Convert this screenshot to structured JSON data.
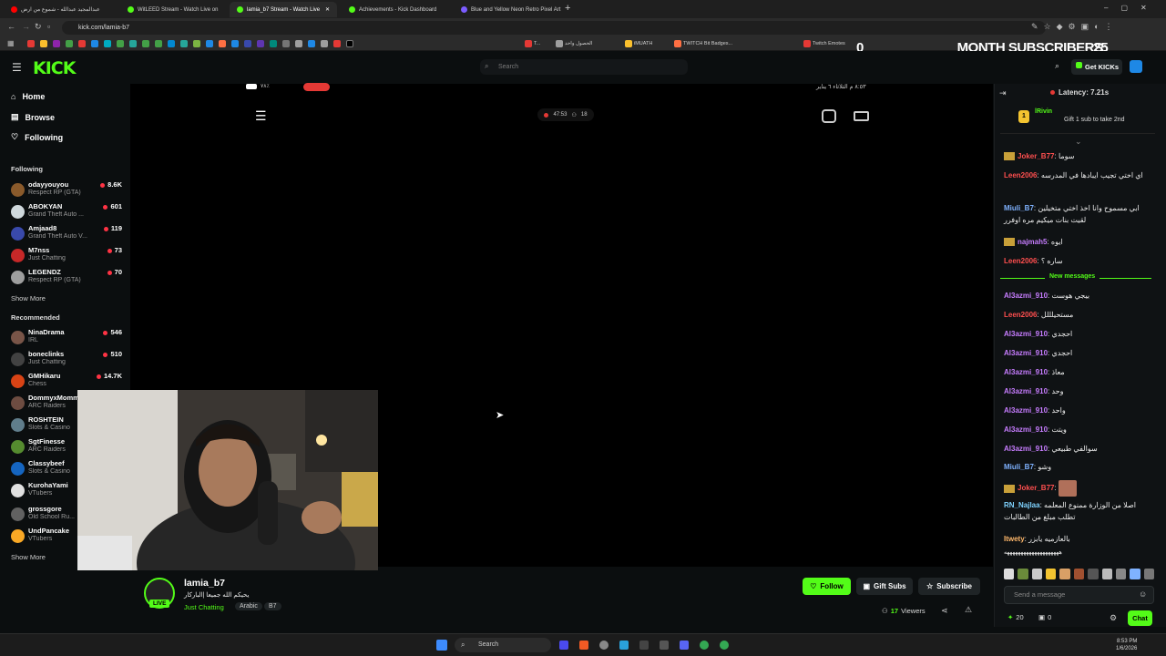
{
  "browser": {
    "tabs": [
      {
        "title": "عبدالمجيد عبدالله - شموع من ارض",
        "icon_color": "#ff0000"
      },
      {
        "title": "WitLEED Stream - Watch Live on",
        "icon_color": "#53fc18"
      },
      {
        "title": "lamia_b7 Stream - Watch Live",
        "icon_color": "#53fc18"
      },
      {
        "title": "Achievements - Kick Dashboard",
        "icon_color": "#53fc18"
      },
      {
        "title": "Blue and Yellow Neon Retro Pixel Art",
        "icon_color": "#7b5cff"
      }
    ],
    "url": "kick.com/lamia-b7",
    "bookmarks": [
      "T...",
      "الحصول واحد",
      "iMUATH",
      "TWITCH Bit Badges...",
      "Twitch Emotes"
    ]
  },
  "overlay": {
    "zero": "0",
    "label": "MONTH SUBSCRIBERS:",
    "count": "25"
  },
  "header": {
    "logo": "KICK",
    "search_placeholder": "Search",
    "get_kicks": "Get KICKs"
  },
  "sidebar": {
    "nav": [
      {
        "label": "Home",
        "icon": "home-icon"
      },
      {
        "label": "Browse",
        "icon": "browse-icon"
      },
      {
        "label": "Following",
        "icon": "heart-icon"
      }
    ],
    "following_title": "Following",
    "following": [
      {
        "name": "odayyouyou",
        "category": "Respect RP (GTA)",
        "viewers": "8.6K",
        "color": "#8a5a2b"
      },
      {
        "name": "ABOKYAN",
        "category": "Grand Theft Auto ...",
        "viewers": "601",
        "color": "#cfd8dc"
      },
      {
        "name": "Amjaad8",
        "category": "Grand Theft Auto V...",
        "viewers": "119",
        "color": "#3949ab"
      },
      {
        "name": "M7nss",
        "category": "Just Chatting",
        "viewers": "73",
        "color": "#c62828"
      },
      {
        "name": "LEGENDZ",
        "category": "Respect RP (GTA)",
        "viewers": "70",
        "color": "#9e9e9e"
      }
    ],
    "show_more_1": "Show More",
    "recommended_title": "Recommended",
    "recommended": [
      {
        "name": "NinaDrama",
        "category": "IRL",
        "viewers": "546",
        "color": "#795548"
      },
      {
        "name": "boneclinks",
        "category": "Just Chatting",
        "viewers": "510",
        "color": "#424242"
      },
      {
        "name": "GMHikaru",
        "category": "Chess",
        "viewers": "14.7K",
        "color": "#d84315"
      },
      {
        "name": "DommyxMommy",
        "category": "ARC Raiders",
        "viewers": "",
        "color": "#6d4c41"
      },
      {
        "name": "ROSHTEIN",
        "category": "Slots & Casino",
        "viewers": "",
        "color": "#607d8b"
      },
      {
        "name": "SgtFinesse",
        "category": "ARC Raiders",
        "viewers": "",
        "color": "#558b2f"
      },
      {
        "name": "Classybeef",
        "category": "Slots & Casino",
        "viewers": "",
        "color": "#1565c0"
      },
      {
        "name": "KurohaYami",
        "category": "VTubers",
        "viewers": "",
        "color": "#e0e0e0"
      },
      {
        "name": "grossgore",
        "category": "Old School Ru...",
        "viewers": "",
        "color": "#616161"
      },
      {
        "name": "UndPancake",
        "category": "VTubers",
        "viewers": "",
        "color": "#f9a825"
      }
    ],
    "show_more_2": "Show More"
  },
  "player": {
    "phone_status_left": "٧٨٪",
    "phone_status_right": "٨:٥٣ م  الثلاثاء ٦ يناير",
    "timer": "47:53",
    "viewer_small": "18"
  },
  "stream": {
    "streamer": "lamia_b7",
    "live_label": "LIVE",
    "title": "يحيكم الله جميعا |الباركار",
    "category": "Just Chatting",
    "tags": [
      "Arabic",
      "B7"
    ],
    "follow": "Follow",
    "gift_subs": "Gift Subs",
    "subscribe": "Subscribe",
    "viewers_count": "17",
    "viewers_label": "Viewers"
  },
  "chat": {
    "latency": "Latency: 7.21s",
    "pinned_user": "lRivin",
    "pinned_count": "1",
    "pinned_text": "Gift 1 sub to take 2nd",
    "new_messages": "New messages",
    "messages_before": [
      {
        "user": "Joker_B77",
        "color": "#ff4f4f",
        "text": "سوما",
        "badge": true
      },
      {
        "user": "Leen2006",
        "color": "#ff4f4f",
        "text": "اي اختي تجيب ايبادها في المدرسه",
        "badge": false
      },
      {
        "user": "Miuli_B7",
        "color": "#7fb2ff",
        "text": "ابي مسموح وانا اخذ اختي متخيلين لقيت بنات ميكيم مره اوفرر",
        "badge": false
      },
      {
        "user": "najmah5",
        "color": "#c77dff",
        "text": "ايوه",
        "badge": true
      },
      {
        "user": "Leen2006",
        "color": "#ff4f4f",
        "text": "ساره ؟",
        "badge": false
      }
    ],
    "messages_after": [
      {
        "user": "Al3azmi_910",
        "color": "#c77dff",
        "text": "بيجي هوست"
      },
      {
        "user": "Leen2006",
        "color": "#ff4f4f",
        "text": "مستحيلللل"
      },
      {
        "user": "Al3azmi_910",
        "color": "#c77dff",
        "text": "احجدي"
      },
      {
        "user": "Al3azmi_910",
        "color": "#c77dff",
        "text": "احجدي"
      },
      {
        "user": "Al3azmi_910",
        "color": "#c77dff",
        "text": "معاذ"
      },
      {
        "user": "Al3azmi_910",
        "color": "#c77dff",
        "text": "وحد"
      },
      {
        "user": "Al3azmi_910",
        "color": "#c77dff",
        "text": "واحد"
      },
      {
        "user": "Al3azmi_910",
        "color": "#c77dff",
        "text": "ويتت"
      },
      {
        "user": "Al3azmi_910",
        "color": "#c77dff",
        "text": "سوالفي طبيعي"
      },
      {
        "user": "Miuli_B7",
        "color": "#7fb2ff",
        "text": "وشو"
      },
      {
        "user": "Joker_B77",
        "color": "#ff4f4f",
        "text": "",
        "badge": true
      },
      {
        "user": "RN_Najlaa",
        "color": "#7fd3ff",
        "text": "اصلا من الوزارة ممنوع المعلمه تطلب مبلغ من الطالبات"
      },
      {
        "user": "Itwety",
        "color": "#ffb86b",
        "text": "بالعازميه يابزر"
      }
    ],
    "tail_text": "ههههههههههههههههههههه",
    "input_placeholder": "Send a message",
    "points": "20",
    "gift_count": "0",
    "chat_button": "Chat"
  },
  "taskbar": {
    "search": "Search",
    "time": "8:53 PM",
    "date": "1/6/2026"
  }
}
